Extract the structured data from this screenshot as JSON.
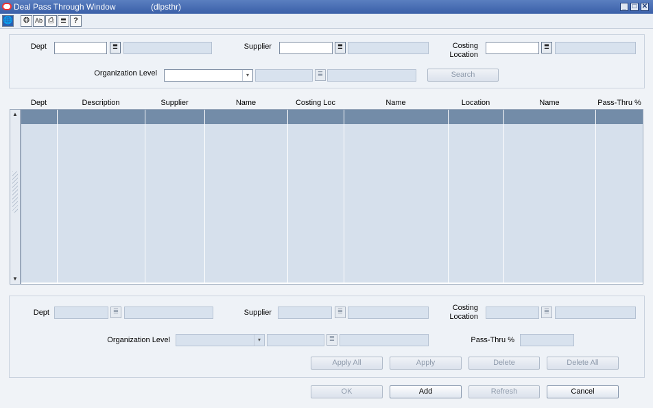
{
  "window": {
    "title": "Deal Pass Through Window",
    "code": "(dlpsthr)",
    "minimize": "_",
    "maximize": "□",
    "close": "✕"
  },
  "toolbar": {
    "icons": [
      "🌐",
      "❂",
      "Ab",
      "⎙",
      "≣",
      "?"
    ]
  },
  "search": {
    "dept_label": "Dept",
    "supplier_label": "Supplier",
    "costing_label": "Costing Location",
    "org_level_label": "Organization Level",
    "search_label": "Search"
  },
  "grid": {
    "columns": [
      "Dept",
      "Description",
      "Supplier",
      "Name",
      "Costing Loc",
      "Name",
      "Location",
      "Name",
      "Pass-Thru %"
    ]
  },
  "detail": {
    "dept_label": "Dept",
    "supplier_label": "Supplier",
    "costing_label": "Costing Location",
    "org_level_label": "Organization Level",
    "passthru_label": "Pass-Thru %"
  },
  "buttons": {
    "apply_all": "Apply All",
    "apply": "Apply",
    "delete": "Delete",
    "delete_all": "Delete All",
    "ok": "OK",
    "add": "Add",
    "refresh": "Refresh",
    "cancel": "Cancel"
  },
  "icons": {
    "lov": "≣",
    "dropdown": "▾",
    "scroll_up": "▲",
    "scroll_down": "▼"
  }
}
